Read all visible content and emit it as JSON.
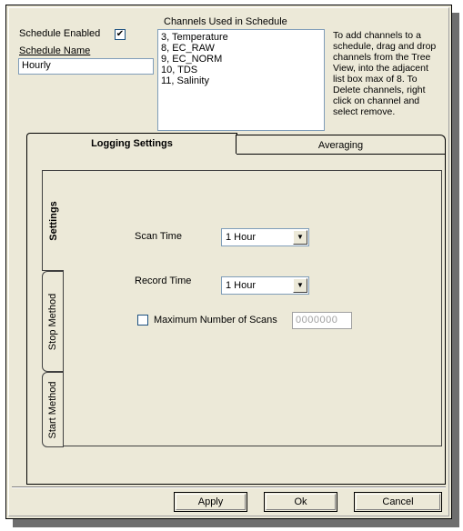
{
  "schedule": {
    "enabled_label": "Schedule Enabled",
    "enabled_checked": true,
    "name_label": "Schedule Name",
    "name_value": "Hourly"
  },
  "channels": {
    "label": "Channels Used in Schedule",
    "items": [
      "3, Temperature",
      "8, EC_RAW",
      "9, EC_NORM",
      "10, TDS",
      "11, Salinity"
    ],
    "help_text": "To add channels to a schedule, drag and drop channels from the Tree View, into the adjacent list box max of 8. To Delete channels, right click on channel and select remove."
  },
  "tabs": {
    "logging_settings": "Logging Settings",
    "averaging": "Averaging"
  },
  "vertical_tabs": {
    "settings": "Settings",
    "stop_method": "Stop Method",
    "start_method": "Start Method"
  },
  "settings": {
    "scan_time_label": "Scan Time",
    "scan_time_value": "1 Hour",
    "record_time_label": "Record Time",
    "record_time_value": "1 Hour",
    "max_scans_label": "Maximum Number of Scans",
    "max_scans_checked": false,
    "max_scans_value": "0000000"
  },
  "buttons": {
    "apply": "Apply",
    "ok": "Ok",
    "cancel": "Cancel"
  }
}
